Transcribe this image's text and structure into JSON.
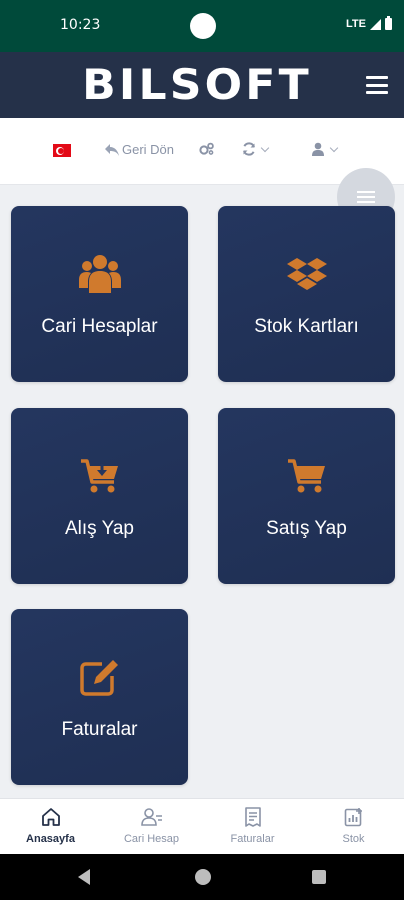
{
  "status_bar": {
    "time": "10:23",
    "network": "LTE"
  },
  "header": {
    "logo_text": "BILSOFT",
    "menu_icon": "hamburger-menu-icon"
  },
  "toolbar": {
    "language_flag": "turkey-flag-icon",
    "back_label": "Geri Dön",
    "back_icon": "reply-arrow-icon",
    "settings_icon": "gears-icon",
    "refresh_icon": "sync-icon",
    "user_icon": "user-icon"
  },
  "tiles": [
    {
      "label": "Cari Hesaplar",
      "icon": "users-icon"
    },
    {
      "label": "Stok Kartları",
      "icon": "dropbox-icon"
    },
    {
      "label": "Alış Yap",
      "icon": "cart-download-icon"
    },
    {
      "label": "Satış Yap",
      "icon": "cart-icon"
    },
    {
      "label": "Faturalar",
      "icon": "edit-icon"
    }
  ],
  "bottom_nav": [
    {
      "label": "Anasayfa",
      "icon": "home-icon",
      "active": true
    },
    {
      "label": "Cari Hesap",
      "icon": "user-card-icon",
      "active": false
    },
    {
      "label": "Faturalar",
      "icon": "receipt-icon",
      "active": false
    },
    {
      "label": "Stok",
      "icon": "chart-icon",
      "active": false
    }
  ],
  "colors": {
    "status_bar": "#004a3a",
    "header": "#253149",
    "tile": "#24365f",
    "icon_accent": "#d07a2d",
    "background": "#eef0f3"
  }
}
